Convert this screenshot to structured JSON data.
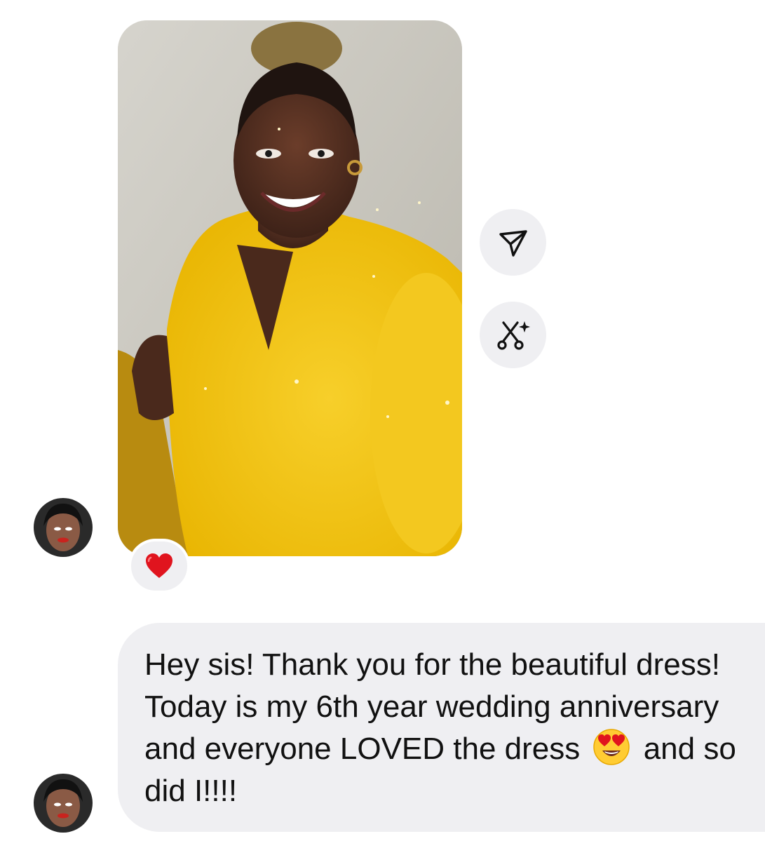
{
  "thread": {
    "photo_message": {
      "image_name": "selfie-yellow-dress-photo",
      "reaction_emoji": "❤️"
    },
    "actions": {
      "share_icon": "paper-plane-icon",
      "edit_icon": "scissors-sparkle-icon"
    },
    "text_message": {
      "before_emoji": "Hey sis! Thank you for the beautiful dress! Today is my 6th year wedding anniversary and everyone LOVED the dress ",
      "emoji": "heart-eyes-emoji",
      "after_emoji": " and so did I!!!!"
    },
    "colors": {
      "bubble_background": "#efeff2",
      "text": "#111111",
      "heart": "#e0141e",
      "dress_yellow": "#f5c518"
    }
  }
}
